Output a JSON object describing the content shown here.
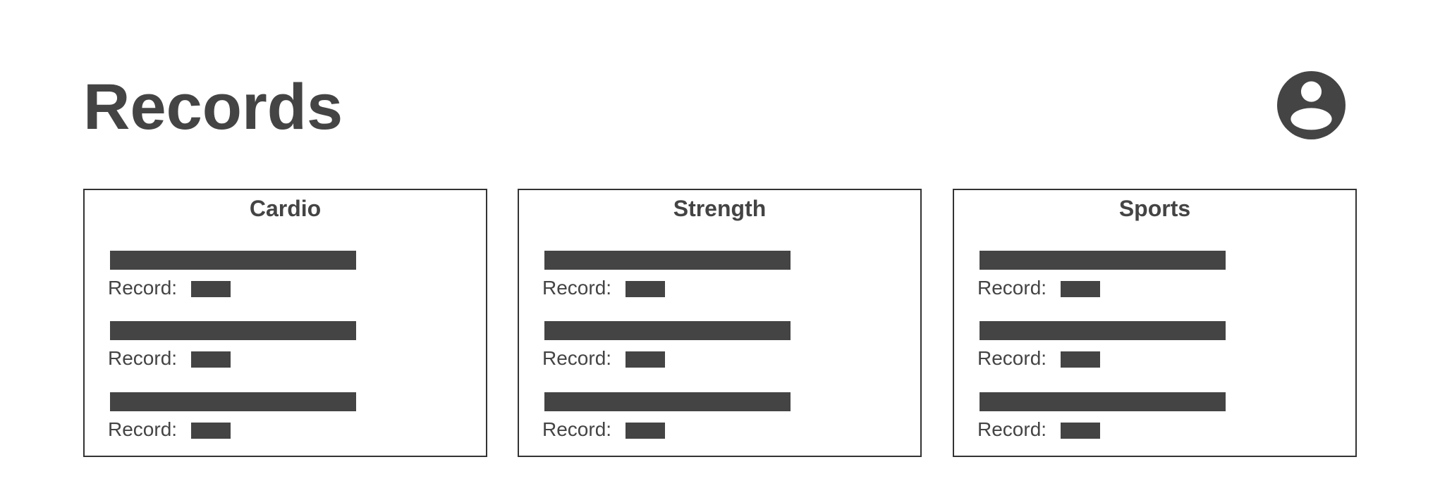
{
  "header": {
    "title": "Records",
    "avatar_icon": "user-circle-icon"
  },
  "colors": {
    "text": "#444444",
    "placeholder": "#444444",
    "border": "#333333",
    "background": "#ffffff"
  },
  "categories": [
    {
      "title": "Cardio",
      "items": [
        {
          "record_label": "Record:"
        },
        {
          "record_label": "Record:"
        },
        {
          "record_label": "Record:"
        }
      ]
    },
    {
      "title": "Strength",
      "items": [
        {
          "record_label": "Record:"
        },
        {
          "record_label": "Record:"
        },
        {
          "record_label": "Record:"
        }
      ]
    },
    {
      "title": "Sports",
      "items": [
        {
          "record_label": "Record:"
        },
        {
          "record_label": "Record:"
        },
        {
          "record_label": "Record:"
        }
      ]
    }
  ]
}
